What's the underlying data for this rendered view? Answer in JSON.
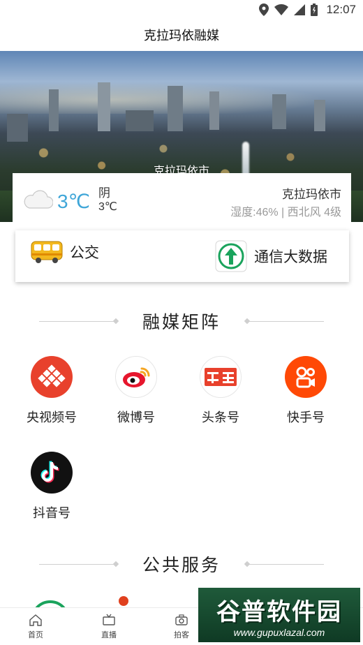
{
  "status_bar": {
    "time": "12:07"
  },
  "header": {
    "title": "克拉玛依融媒"
  },
  "banner": {
    "caption": "克拉玛依市"
  },
  "weather": {
    "temperature": "3℃",
    "condition": "阴",
    "low_temp": "3℃",
    "city": "克拉玛依市",
    "detail": "湿度:46% | 西北风 4级",
    "temp_color": "#3fa6d8"
  },
  "quick_actions": [
    {
      "label": "公交",
      "icon": "bus-icon"
    },
    {
      "label": "通信大数据",
      "icon": "upload-arrow-icon"
    }
  ],
  "media_section": {
    "title": "融媒矩阵",
    "items": [
      {
        "label": "央视频号",
        "icon": "cctv-video-icon",
        "color": "#e8412c"
      },
      {
        "label": "微博号",
        "icon": "weibo-icon",
        "color": "#e6162d"
      },
      {
        "label": "头条号",
        "icon": "toutiao-icon",
        "color": "#e8412c"
      },
      {
        "label": "快手号",
        "icon": "kuaishou-icon",
        "color": "#ff4906"
      },
      {
        "label": "抖音号",
        "icon": "douyin-icon",
        "color": "#111111"
      }
    ]
  },
  "services_section": {
    "title": "公共服务"
  },
  "bottom_nav": [
    {
      "label": "首页",
      "icon": "home-icon"
    },
    {
      "label": "直播",
      "icon": "tv-icon"
    },
    {
      "label": "拍客",
      "icon": "camera-icon"
    }
  ],
  "watermark": {
    "text": "谷普软件园",
    "url": "www.gupuxlazal.com"
  }
}
